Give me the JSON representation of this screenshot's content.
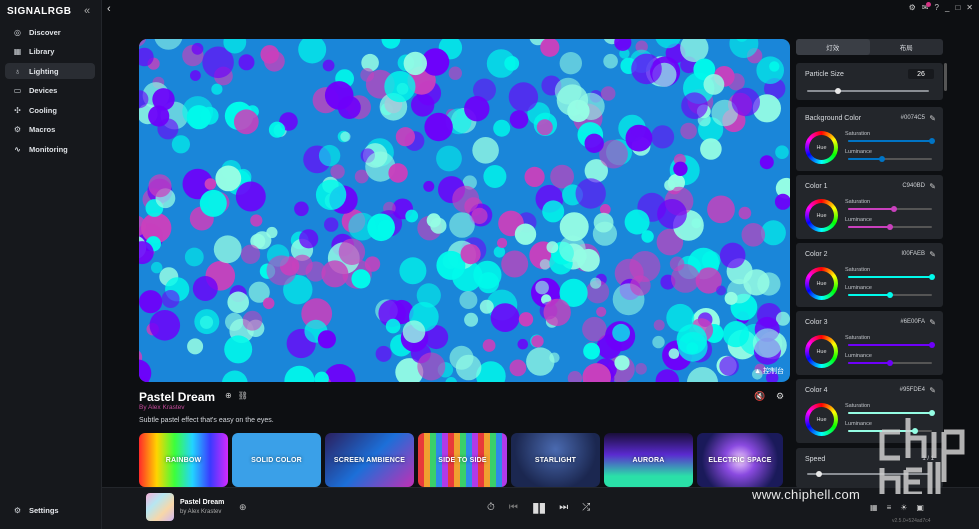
{
  "app": {
    "logo": "SIGNALRGB",
    "back_icon": "chevron-left-icon"
  },
  "sidebar": {
    "items": [
      {
        "label": "Discover",
        "icon": "compass-icon",
        "glyph": "◎"
      },
      {
        "label": "Library",
        "icon": "grid-icon",
        "glyph": "▦"
      },
      {
        "label": "Lighting",
        "icon": "bulb-icon",
        "glyph": "♁",
        "active": true
      },
      {
        "label": "Devices",
        "icon": "keyboard-icon",
        "glyph": "▭"
      },
      {
        "label": "Cooling",
        "icon": "fan-icon",
        "glyph": "✣"
      },
      {
        "label": "Macros",
        "icon": "macro-icon",
        "glyph": "⚙"
      },
      {
        "label": "Monitoring",
        "icon": "pulse-icon",
        "glyph": "∿"
      }
    ],
    "settings_label": "Settings"
  },
  "preview": {
    "console_label": "▲ 控制台"
  },
  "effect": {
    "title": "Pastel Dream",
    "author": "By Alex Krastev",
    "description": "Subtle pastel effect that's easy on the eyes."
  },
  "thumbnails": [
    {
      "label": "RAINBOW",
      "bg": "linear-gradient(90deg,#ff2a2a,#ffd400,#3cff3c,#22d4ff,#3a3aff,#d42aff)"
    },
    {
      "label": "SOLID COLOR",
      "bg": "#3aa0e8"
    },
    {
      "label": "SCREEN AMBIENCE",
      "bg": "linear-gradient(135deg,#2b1f5e,#1c6fd8 50%,#c22fb5)"
    },
    {
      "label": "SIDE TO SIDE",
      "bg": "repeating-linear-gradient(90deg,#e83a3a 0 6px,#f0a030 6px 12px,#3ad06a 12px 18px,#2e8ae8 18px 24px,#b03ae8 24px 30px)"
    },
    {
      "label": "STARLIGHT",
      "bg": "radial-gradient(circle at 50% 30%,#4a6ab0,#1b2750 70%)"
    },
    {
      "label": "AURORA",
      "bg": "linear-gradient(180deg,#1a0e3a,#5a2ad0 40%,#2ae0a8 80%)"
    },
    {
      "label": "ELECTRIC SPACE",
      "bg": "radial-gradient(circle at 50% 50%,#f2d0ff,#8a4ae0 30%,#1a1a5a 75%)"
    }
  ],
  "panel": {
    "tabs": [
      "灯效",
      "布局"
    ],
    "particle_size": {
      "label": "Particle Size",
      "value": "26"
    },
    "colors": [
      {
        "label": "Background Color",
        "hex": "#0074C5",
        "color": "#0074c5",
        "saturation": 1.0,
        "luminance": 0.4
      },
      {
        "label": "Color 1",
        "hex": "C940BD",
        "color": "#c940bd",
        "saturation": 0.55,
        "luminance": 0.5
      },
      {
        "label": "Color 2",
        "hex": "I00FAEB",
        "color": "#00faeb",
        "saturation": 1.0,
        "luminance": 0.5
      },
      {
        "label": "Color 3",
        "hex": "#6E00FA",
        "color": "#6e00fa",
        "saturation": 1.0,
        "luminance": 0.5
      },
      {
        "label": "Color 4",
        "hex": "#95FDE4",
        "color": "#95fde4",
        "saturation": 1.0,
        "luminance": 0.8
      }
    ],
    "sub_labels": {
      "hue": "Hue",
      "saturation": "Saturation",
      "luminance": "Luminance"
    },
    "speed": {
      "label": "Speed",
      "value": "1 / 1"
    }
  },
  "player": {
    "title": "Pastel Dream",
    "author": "by Alex Krastev",
    "version": "v2.5.0+524ad7c4"
  },
  "watermark": "www.chiphell.com"
}
